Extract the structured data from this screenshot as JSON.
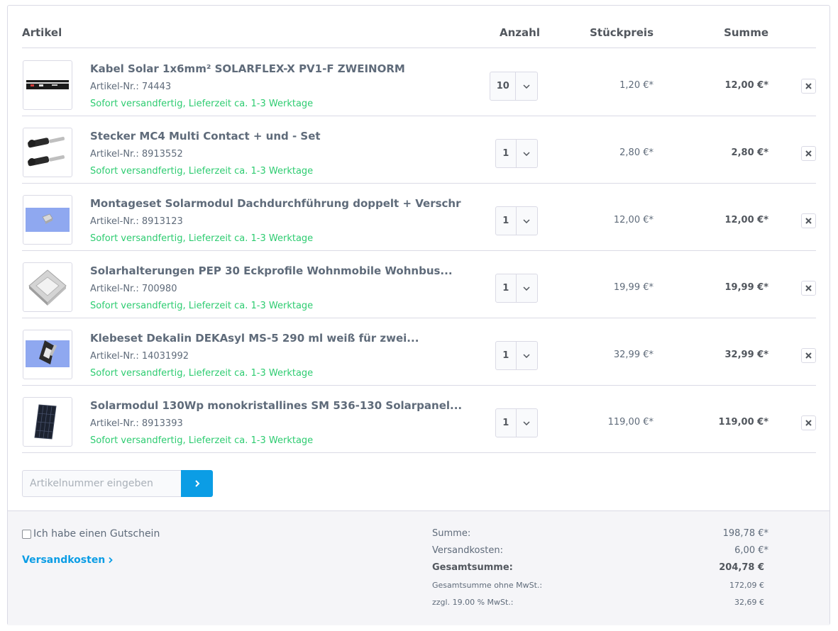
{
  "header": {
    "col_article": "Artikel",
    "col_quantity": "Anzahl",
    "col_unit_price": "Stückpreis",
    "col_sum": "Summe"
  },
  "items": [
    {
      "name": "Kabel Solar 1x6mm² SOLARFLEX-X PV1-F ZWEINORM",
      "article_no": "Artikel-Nr.: 74443",
      "delivery": "Sofort versandfertig, Lieferzeit ca. 1-3 Werktage",
      "quantity": "10",
      "unit_price": "1,20 €*",
      "total": "12,00 €*",
      "thumb_icon": "cable-image"
    },
    {
      "name": "Stecker MC4 Multi Contact + und - Set",
      "article_no": "Artikel-Nr.: 8913552",
      "delivery": "Sofort versandfertig, Lieferzeit ca. 1-3 Werktage",
      "quantity": "1",
      "unit_price": "2,80 €*",
      "total": "2,80 €*",
      "thumb_icon": "connector-image"
    },
    {
      "name": "Montageset Solarmodul Dachdurchführung doppelt + Verschr",
      "article_no": "Artikel-Nr.: 8913123",
      "delivery": "Sofort versandfertig, Lieferzeit ca. 1-3 Werktage",
      "quantity": "1",
      "unit_price": "12,00 €*",
      "total": "12,00 €*",
      "thumb_icon": "roof-feedthrough-image"
    },
    {
      "name": "Solarhalterungen PEP 30 Eckprofile Wohnmobile Wohnbus...",
      "article_no": "Artikel-Nr.: 700980",
      "delivery": "Sofort versandfertig, Lieferzeit ca. 1-3 Werktage",
      "quantity": "1",
      "unit_price": "19,99 €*",
      "total": "19,99 €*",
      "thumb_icon": "corner-bracket-image"
    },
    {
      "name": "Klebeset Dekalin DEKAsyl MS-5 290 ml weiß für zwei...",
      "article_no": "Artikel-Nr.: 14031992",
      "delivery": "Sofort versandfertig, Lieferzeit ca. 1-3 Werktage",
      "quantity": "1",
      "unit_price": "32,99 €*",
      "total": "32,99 €*",
      "thumb_icon": "adhesive-set-image"
    },
    {
      "name": "Solarmodul 130Wp monokristallines SM 536-130 Solarpanel...",
      "article_no": "Artikel-Nr.: 8913393",
      "delivery": "Sofort versandfertig, Lieferzeit ca. 1-3 Werktage",
      "quantity": "1",
      "unit_price": "119,00 €*",
      "total": "119,00 €*",
      "thumb_icon": "solar-panel-image"
    }
  ],
  "add_article": {
    "placeholder": "Artikelnummer eingeben",
    "button_icon": "chevron-right-icon"
  },
  "footer": {
    "voucher_label": "Ich habe einen Gutschein",
    "shipping_link": "Versandkosten",
    "summary": {
      "subtotal_label": "Summe:",
      "subtotal_value": "198,78 €*",
      "shipping_label": "Versandkosten:",
      "shipping_value": "6,00 €*",
      "grand_total_label": "Gesamtsumme:",
      "grand_total_value": "204,78 €",
      "net_label": "Gesamtsumme ohne MwSt.:",
      "net_value": "172,09 €",
      "vat_label": "zzgl. 19.00 % MwSt.:",
      "vat_value": "32,69 €"
    }
  },
  "colors": {
    "accent": "#0b9de5",
    "delivery_green": "#2ecc71",
    "border": "#dadae5",
    "text": "#5f6b7a"
  }
}
